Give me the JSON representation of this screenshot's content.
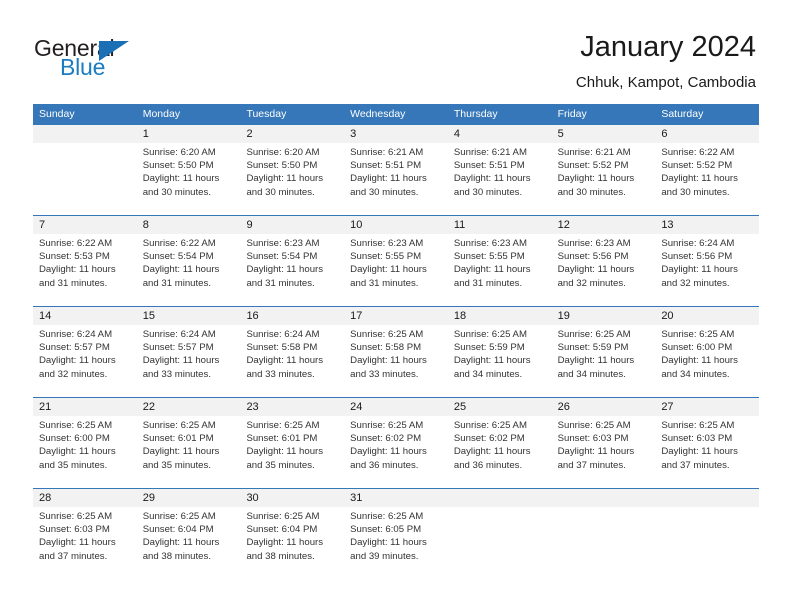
{
  "brand": {
    "name_top": "General",
    "name_bottom": "Blue",
    "accent_color": "#1b6fb5",
    "text_color": "#231f20"
  },
  "header": {
    "title": "January 2024",
    "subtitle": "Chhuk, Kampot, Cambodia"
  },
  "theme": {
    "header_bg": "#3577b8",
    "header_text": "#ffffff",
    "daynum_bg": "#f2f2f2",
    "grid_line": "#3577b8"
  },
  "calendar": {
    "weekdays": [
      "Sunday",
      "Monday",
      "Tuesday",
      "Wednesday",
      "Thursday",
      "Friday",
      "Saturday"
    ],
    "weeks": [
      [
        {
          "day": "",
          "sunrise": "",
          "sunset": "",
          "daylight1": "",
          "daylight2": ""
        },
        {
          "day": "1",
          "sunrise": "Sunrise: 6:20 AM",
          "sunset": "Sunset: 5:50 PM",
          "daylight1": "Daylight: 11 hours",
          "daylight2": "and 30 minutes."
        },
        {
          "day": "2",
          "sunrise": "Sunrise: 6:20 AM",
          "sunset": "Sunset: 5:50 PM",
          "daylight1": "Daylight: 11 hours",
          "daylight2": "and 30 minutes."
        },
        {
          "day": "3",
          "sunrise": "Sunrise: 6:21 AM",
          "sunset": "Sunset: 5:51 PM",
          "daylight1": "Daylight: 11 hours",
          "daylight2": "and 30 minutes."
        },
        {
          "day": "4",
          "sunrise": "Sunrise: 6:21 AM",
          "sunset": "Sunset: 5:51 PM",
          "daylight1": "Daylight: 11 hours",
          "daylight2": "and 30 minutes."
        },
        {
          "day": "5",
          "sunrise": "Sunrise: 6:21 AM",
          "sunset": "Sunset: 5:52 PM",
          "daylight1": "Daylight: 11 hours",
          "daylight2": "and 30 minutes."
        },
        {
          "day": "6",
          "sunrise": "Sunrise: 6:22 AM",
          "sunset": "Sunset: 5:52 PM",
          "daylight1": "Daylight: 11 hours",
          "daylight2": "and 30 minutes."
        }
      ],
      [
        {
          "day": "7",
          "sunrise": "Sunrise: 6:22 AM",
          "sunset": "Sunset: 5:53 PM",
          "daylight1": "Daylight: 11 hours",
          "daylight2": "and 31 minutes."
        },
        {
          "day": "8",
          "sunrise": "Sunrise: 6:22 AM",
          "sunset": "Sunset: 5:54 PM",
          "daylight1": "Daylight: 11 hours",
          "daylight2": "and 31 minutes."
        },
        {
          "day": "9",
          "sunrise": "Sunrise: 6:23 AM",
          "sunset": "Sunset: 5:54 PM",
          "daylight1": "Daylight: 11 hours",
          "daylight2": "and 31 minutes."
        },
        {
          "day": "10",
          "sunrise": "Sunrise: 6:23 AM",
          "sunset": "Sunset: 5:55 PM",
          "daylight1": "Daylight: 11 hours",
          "daylight2": "and 31 minutes."
        },
        {
          "day": "11",
          "sunrise": "Sunrise: 6:23 AM",
          "sunset": "Sunset: 5:55 PM",
          "daylight1": "Daylight: 11 hours",
          "daylight2": "and 31 minutes."
        },
        {
          "day": "12",
          "sunrise": "Sunrise: 6:23 AM",
          "sunset": "Sunset: 5:56 PM",
          "daylight1": "Daylight: 11 hours",
          "daylight2": "and 32 minutes."
        },
        {
          "day": "13",
          "sunrise": "Sunrise: 6:24 AM",
          "sunset": "Sunset: 5:56 PM",
          "daylight1": "Daylight: 11 hours",
          "daylight2": "and 32 minutes."
        }
      ],
      [
        {
          "day": "14",
          "sunrise": "Sunrise: 6:24 AM",
          "sunset": "Sunset: 5:57 PM",
          "daylight1": "Daylight: 11 hours",
          "daylight2": "and 32 minutes."
        },
        {
          "day": "15",
          "sunrise": "Sunrise: 6:24 AM",
          "sunset": "Sunset: 5:57 PM",
          "daylight1": "Daylight: 11 hours",
          "daylight2": "and 33 minutes."
        },
        {
          "day": "16",
          "sunrise": "Sunrise: 6:24 AM",
          "sunset": "Sunset: 5:58 PM",
          "daylight1": "Daylight: 11 hours",
          "daylight2": "and 33 minutes."
        },
        {
          "day": "17",
          "sunrise": "Sunrise: 6:25 AM",
          "sunset": "Sunset: 5:58 PM",
          "daylight1": "Daylight: 11 hours",
          "daylight2": "and 33 minutes."
        },
        {
          "day": "18",
          "sunrise": "Sunrise: 6:25 AM",
          "sunset": "Sunset: 5:59 PM",
          "daylight1": "Daylight: 11 hours",
          "daylight2": "and 34 minutes."
        },
        {
          "day": "19",
          "sunrise": "Sunrise: 6:25 AM",
          "sunset": "Sunset: 5:59 PM",
          "daylight1": "Daylight: 11 hours",
          "daylight2": "and 34 minutes."
        },
        {
          "day": "20",
          "sunrise": "Sunrise: 6:25 AM",
          "sunset": "Sunset: 6:00 PM",
          "daylight1": "Daylight: 11 hours",
          "daylight2": "and 34 minutes."
        }
      ],
      [
        {
          "day": "21",
          "sunrise": "Sunrise: 6:25 AM",
          "sunset": "Sunset: 6:00 PM",
          "daylight1": "Daylight: 11 hours",
          "daylight2": "and 35 minutes."
        },
        {
          "day": "22",
          "sunrise": "Sunrise: 6:25 AM",
          "sunset": "Sunset: 6:01 PM",
          "daylight1": "Daylight: 11 hours",
          "daylight2": "and 35 minutes."
        },
        {
          "day": "23",
          "sunrise": "Sunrise: 6:25 AM",
          "sunset": "Sunset: 6:01 PM",
          "daylight1": "Daylight: 11 hours",
          "daylight2": "and 35 minutes."
        },
        {
          "day": "24",
          "sunrise": "Sunrise: 6:25 AM",
          "sunset": "Sunset: 6:02 PM",
          "daylight1": "Daylight: 11 hours",
          "daylight2": "and 36 minutes."
        },
        {
          "day": "25",
          "sunrise": "Sunrise: 6:25 AM",
          "sunset": "Sunset: 6:02 PM",
          "daylight1": "Daylight: 11 hours",
          "daylight2": "and 36 minutes."
        },
        {
          "day": "26",
          "sunrise": "Sunrise: 6:25 AM",
          "sunset": "Sunset: 6:03 PM",
          "daylight1": "Daylight: 11 hours",
          "daylight2": "and 37 minutes."
        },
        {
          "day": "27",
          "sunrise": "Sunrise: 6:25 AM",
          "sunset": "Sunset: 6:03 PM",
          "daylight1": "Daylight: 11 hours",
          "daylight2": "and 37 minutes."
        }
      ],
      [
        {
          "day": "28",
          "sunrise": "Sunrise: 6:25 AM",
          "sunset": "Sunset: 6:03 PM",
          "daylight1": "Daylight: 11 hours",
          "daylight2": "and 37 minutes."
        },
        {
          "day": "29",
          "sunrise": "Sunrise: 6:25 AM",
          "sunset": "Sunset: 6:04 PM",
          "daylight1": "Daylight: 11 hours",
          "daylight2": "and 38 minutes."
        },
        {
          "day": "30",
          "sunrise": "Sunrise: 6:25 AM",
          "sunset": "Sunset: 6:04 PM",
          "daylight1": "Daylight: 11 hours",
          "daylight2": "and 38 minutes."
        },
        {
          "day": "31",
          "sunrise": "Sunrise: 6:25 AM",
          "sunset": "Sunset: 6:05 PM",
          "daylight1": "Daylight: 11 hours",
          "daylight2": "and 39 minutes."
        },
        {
          "day": "",
          "sunrise": "",
          "sunset": "",
          "daylight1": "",
          "daylight2": ""
        },
        {
          "day": "",
          "sunrise": "",
          "sunset": "",
          "daylight1": "",
          "daylight2": ""
        },
        {
          "day": "",
          "sunrise": "",
          "sunset": "",
          "daylight1": "",
          "daylight2": ""
        }
      ]
    ]
  }
}
